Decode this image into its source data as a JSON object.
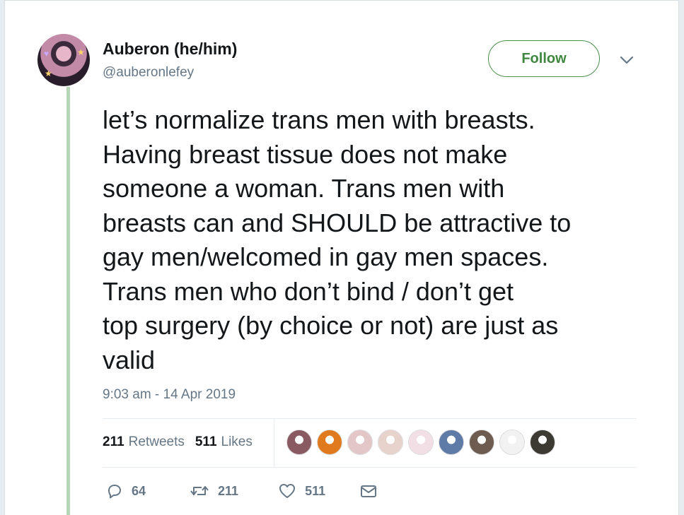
{
  "author": {
    "name": "Auberon (he/him)",
    "handle": "@auberonlefey"
  },
  "follow_label": "Follow",
  "tweet": {
    "text": "let’s normalize trans men with breasts.\nHaving breast tissue does not make\nsomeone a woman. Trans men with\nbreasts can and SHOULD be attractive to\ngay men/welcomed in gay men spaces.\nTrans men who don’t bind / don’t get\ntop surgery (by choice or not) are just as\nvalid",
    "timestamp": "9:03 am - 14 Apr 2019"
  },
  "stats": {
    "retweets_count": "211",
    "retweets_label": "Retweets",
    "likes_count": "511",
    "likes_label": "Likes"
  },
  "likers": [
    {
      "color": "#8a5a63"
    },
    {
      "color": "#e07a1e"
    },
    {
      "color": "#e3c7c8"
    },
    {
      "color": "#e8d3cc"
    },
    {
      "color": "#f2dfe6"
    },
    {
      "color": "#5e7aa6"
    },
    {
      "color": "#6d5c4f"
    },
    {
      "color": "#f2f2f2"
    },
    {
      "color": "#3c3a32"
    }
  ],
  "actions": {
    "reply_count": "64",
    "retweet_count": "211",
    "like_count": "511"
  },
  "colors": {
    "accent": "#3f873f",
    "thread_line": "#b5d7b8",
    "secondary_text": "#657786"
  },
  "icons": [
    "chevron-down-icon",
    "reply-icon",
    "retweet-icon",
    "heart-icon",
    "message-icon"
  ]
}
